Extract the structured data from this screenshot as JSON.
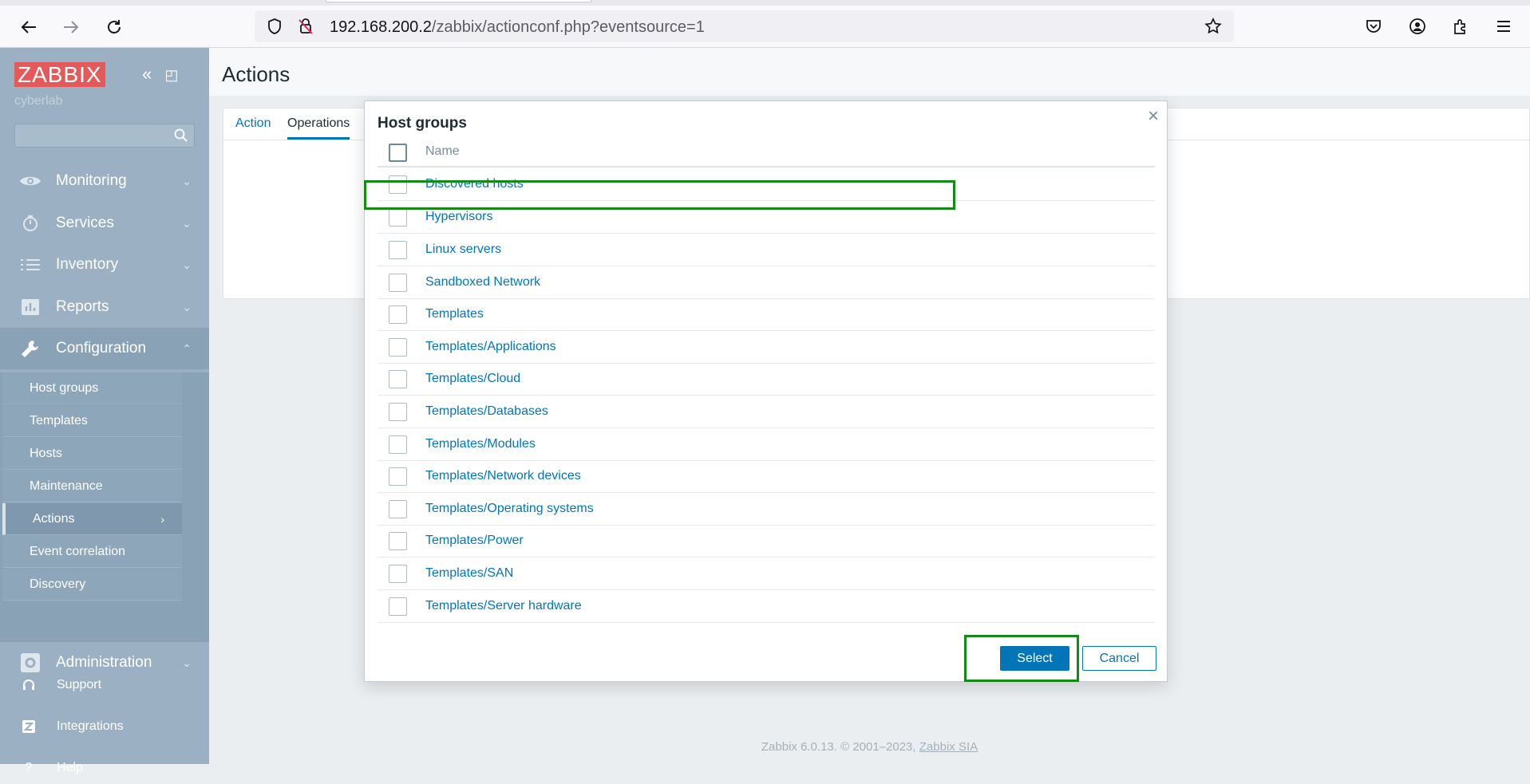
{
  "browser": {
    "url_host": "192.168.200.2",
    "url_path": "/zabbix/actionconf.php?eventsource=1"
  },
  "sidebar": {
    "logo": "ZABBIX",
    "org": "cyberlab",
    "menu": [
      {
        "label": "Monitoring",
        "icon": "eye-icon"
      },
      {
        "label": "Services",
        "icon": "clock-icon"
      },
      {
        "label": "Inventory",
        "icon": "list-icon"
      },
      {
        "label": "Reports",
        "icon": "bar-chart-icon"
      },
      {
        "label": "Configuration",
        "icon": "wrench-icon"
      }
    ],
    "submenu": [
      "Host groups",
      "Templates",
      "Hosts",
      "Maintenance",
      "Actions",
      "Event correlation",
      "Discovery"
    ],
    "administration": "Administration",
    "bottom": [
      "Support",
      "Integrations",
      "Help"
    ]
  },
  "page": {
    "title": "Actions",
    "tabs": [
      "Action",
      "Operations"
    ]
  },
  "dialog": {
    "title": "Host groups",
    "column_name": "Name",
    "rows": [
      "Discovered hosts",
      "Hypervisors",
      "Linux servers",
      "Sandboxed Network",
      "Templates",
      "Templates/Applications",
      "Templates/Cloud",
      "Templates/Databases",
      "Templates/Modules",
      "Templates/Network devices",
      "Templates/Operating systems",
      "Templates/Power",
      "Templates/SAN",
      "Templates/Server hardware"
    ],
    "select_label": "Select",
    "cancel_label": "Cancel"
  },
  "footer": {
    "text": "Zabbix 6.0.13. © 2001–2023, ",
    "link": "Zabbix SIA"
  },
  "colors": {
    "sidebar_bg": "#9bb1c3",
    "brand_red": "#e45959",
    "link_blue": "#0275b8",
    "highlight_green": "#138a16"
  }
}
